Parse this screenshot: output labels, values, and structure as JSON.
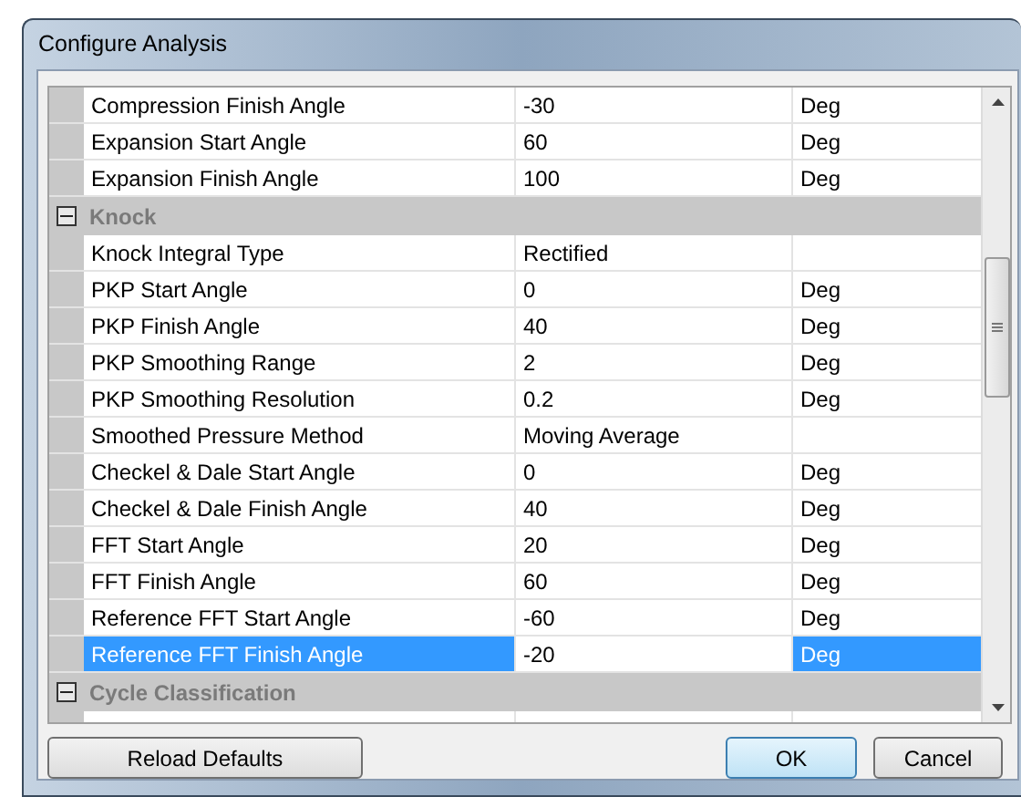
{
  "window": {
    "title": "Configure Analysis"
  },
  "grid": {
    "rows": [
      {
        "kind": "property",
        "name": "Compression Finish Angle",
        "value": "-30",
        "unit": "Deg",
        "selected": false
      },
      {
        "kind": "property",
        "name": "Expansion Start Angle",
        "value": "60",
        "unit": "Deg",
        "selected": false
      },
      {
        "kind": "property",
        "name": "Expansion Finish Angle",
        "value": "100",
        "unit": "Deg",
        "selected": false
      },
      {
        "kind": "category",
        "name": "Knock",
        "expanded": true
      },
      {
        "kind": "property",
        "name": "Knock Integral Type",
        "value": "Rectified",
        "selected": false
      },
      {
        "kind": "property",
        "name": "PKP Start Angle",
        "value": "0",
        "unit": "Deg",
        "selected": false
      },
      {
        "kind": "property",
        "name": "PKP Finish Angle",
        "value": "40",
        "unit": "Deg",
        "selected": false
      },
      {
        "kind": "property",
        "name": "PKP Smoothing Range",
        "value": "2",
        "unit": "Deg",
        "selected": false
      },
      {
        "kind": "property",
        "name": "PKP Smoothing Resolution",
        "value": "0.2",
        "unit": "Deg",
        "selected": false
      },
      {
        "kind": "property",
        "name": "Smoothed Pressure Method",
        "value": "Moving Average",
        "selected": false
      },
      {
        "kind": "property",
        "name": "Checkel & Dale Start Angle",
        "value": "0",
        "unit": "Deg",
        "selected": false
      },
      {
        "kind": "property",
        "name": "Checkel & Dale Finish Angle",
        "value": "40",
        "unit": "Deg",
        "selected": false
      },
      {
        "kind": "property",
        "name": "FFT Start Angle",
        "value": "20",
        "unit": "Deg",
        "selected": false
      },
      {
        "kind": "property",
        "name": "FFT Finish Angle",
        "value": "60",
        "unit": "Deg",
        "selected": false
      },
      {
        "kind": "property",
        "name": "Reference FFT Start Angle",
        "value": "-60",
        "unit": "Deg",
        "selected": false
      },
      {
        "kind": "property",
        "name": "Reference FFT Finish Angle",
        "value": "-20",
        "unit": "Deg",
        "selected": true
      },
      {
        "kind": "category",
        "name": "Cycle Classification",
        "expanded": true
      }
    ]
  },
  "buttons": [
    {
      "label": "Reload Defaults",
      "default": false
    },
    {
      "label": "OK",
      "default": true
    },
    {
      "label": "Cancel",
      "default": false
    }
  ]
}
